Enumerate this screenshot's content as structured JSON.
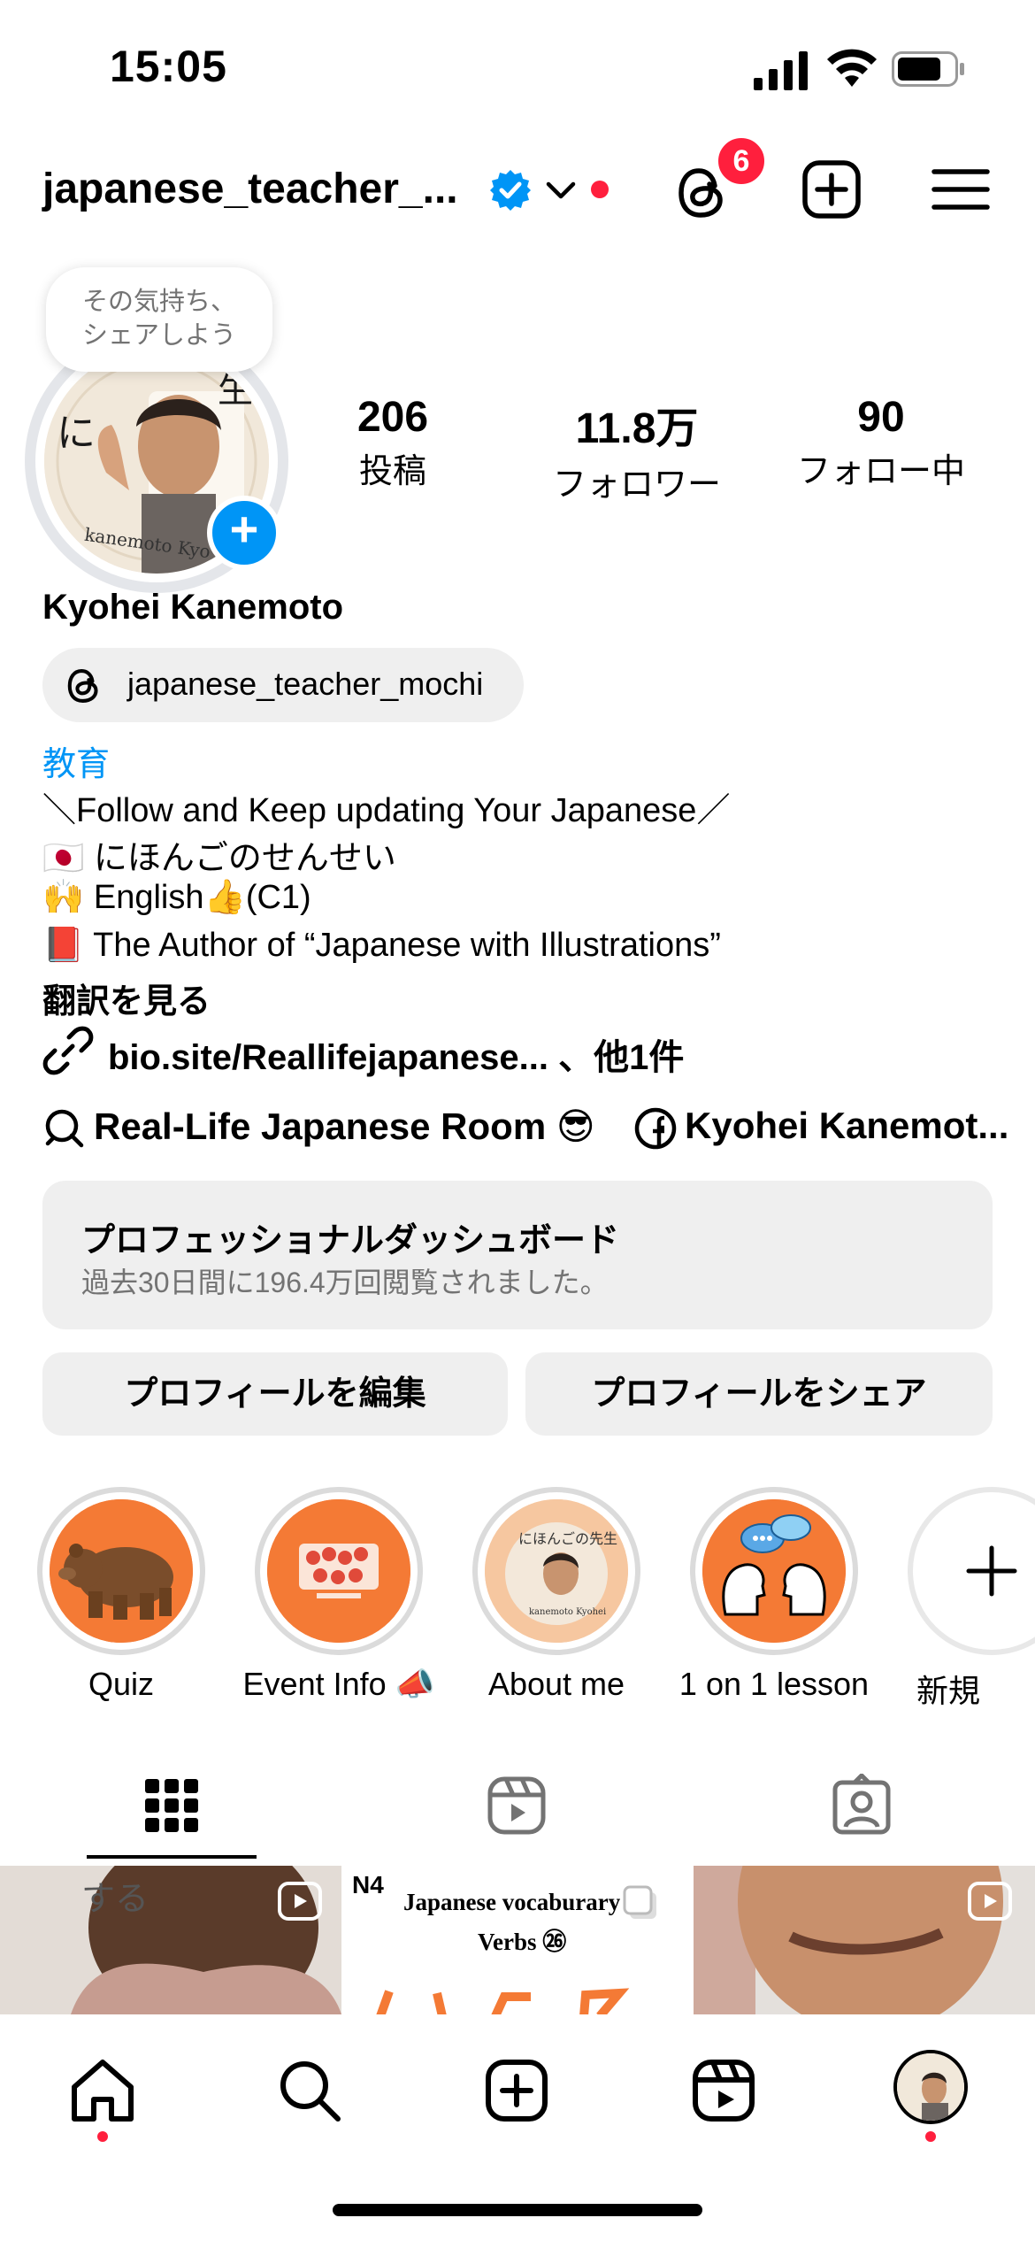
{
  "status_bar": {
    "time": "15:05"
  },
  "header": {
    "username": "japanese_teacher_...",
    "threads_badge": "6",
    "icons": [
      "verified-badge-icon",
      "chevron-down-icon",
      "threads-icon",
      "create-plus-icon",
      "menu-icon"
    ]
  },
  "profile": {
    "note_bubble": [
      "その気持ち、",
      "シェアしよう"
    ],
    "stats": [
      {
        "value": "206",
        "label": "投稿"
      },
      {
        "value": "11.8万",
        "label": "フォロワー"
      },
      {
        "value": "90",
        "label": "フォロー中"
      }
    ],
    "full_name": "Kyohei Kanemoto",
    "threads_handle": "japanese_teacher_mochi",
    "category": "教育",
    "bio_lines": [
      "＼Follow and Keep updating Your Japanese／",
      "🇯🇵 にほんごのせんせい",
      "🙌 English👍(C1)",
      "📕 The Author of “Japanese with Illustrations”"
    ],
    "translate_label": "翻訳を見る",
    "link_text": "bio.site/Reallifejapanese... 、他1件",
    "channel_chip": "Real-Life Japanese Room 😎",
    "facebook_chip": "Kyohei Kanemot..."
  },
  "dashboard": {
    "title": "プロフェッショナルダッシュボード",
    "subtitle": "過去30日間に196.4万回閲覧されました。"
  },
  "buttons": {
    "edit_profile": "プロフィールを編集",
    "share_profile": "プロフィールをシェア"
  },
  "highlights": [
    {
      "label": "Quiz"
    },
    {
      "label": "Event Info 📣"
    },
    {
      "label": "About me"
    },
    {
      "label": "1 on 1 lesson"
    },
    {
      "label": "新規"
    }
  ],
  "grid_preview": {
    "tile2_level": "N4",
    "tile2_line1": "Japanese vocaburary",
    "tile2_line2": "Verbs ㉖"
  },
  "colors": {
    "accent_blue": "#0095f6",
    "notification_red": "#ff1f3d",
    "highlight_orange": "#f47a35",
    "surface_gray": "#efefef"
  }
}
